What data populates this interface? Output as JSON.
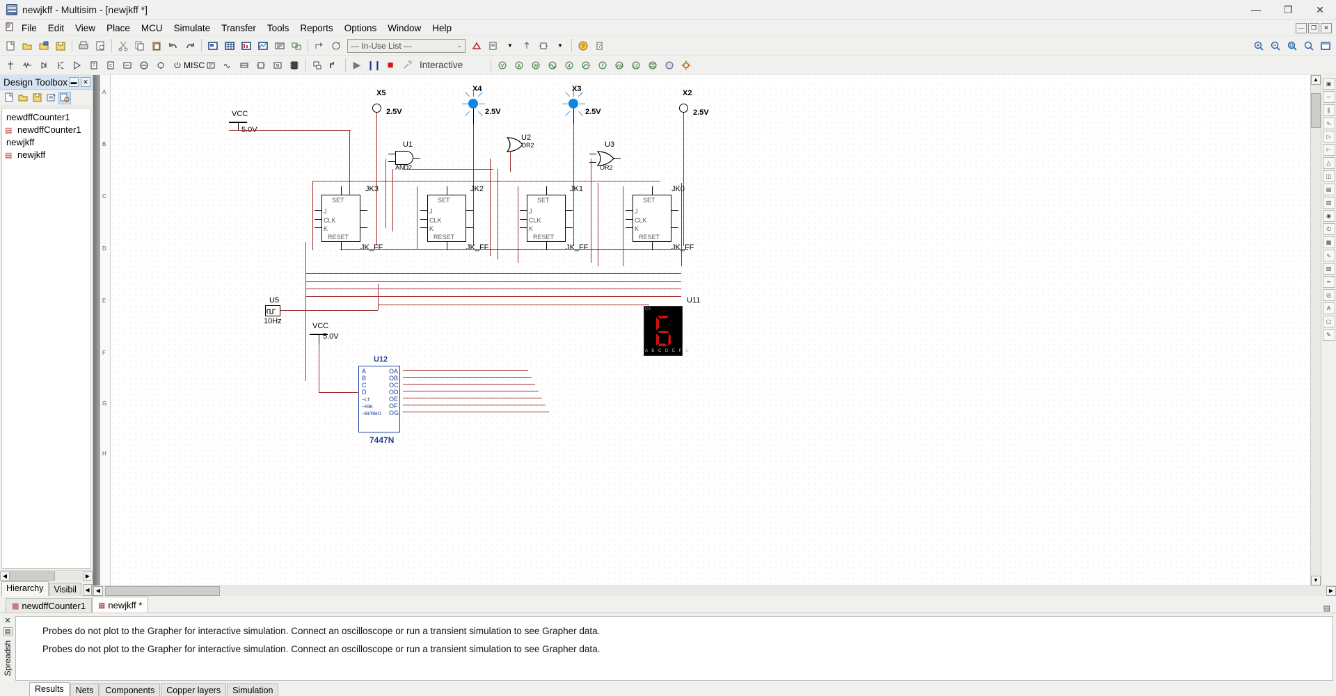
{
  "window": {
    "title": "newjkff - Multisim - [newjkff *]",
    "app_icon": "multisim-icon",
    "buttons": {
      "minimize": "—",
      "maximize": "❐",
      "close": "✕"
    }
  },
  "menubar": {
    "items": [
      "File",
      "Edit",
      "View",
      "Place",
      "MCU",
      "Simulate",
      "Transfer",
      "Tools",
      "Reports",
      "Options",
      "Window",
      "Help"
    ],
    "mdi_buttons": [
      "—",
      "❐",
      "✕"
    ]
  },
  "toolbar_main": {
    "groups": [
      [
        "new-document-icon",
        "open-document-icon",
        "open-design-icon",
        "save-icon"
      ],
      [
        "print-icon",
        "print-preview-icon"
      ],
      [
        "cut-icon",
        "copy-icon",
        "paste-icon",
        "undo-icon",
        "redo-icon"
      ],
      [
        "full-screen-icon",
        "grapher-icon",
        "postprocessor-icon",
        "analysis-icon",
        "electrical-rules-check-icon",
        "capture-screen-area-icon"
      ],
      [
        "back-annotate-icon",
        "forward-annotate-icon"
      ]
    ],
    "in_use_list": {
      "label": "--- In-Use List ---",
      "arrow": "⌄"
    },
    "right_icons": [
      "component-wizard-icon",
      "database-manager-icon",
      "dropdown-arrow-icon",
      "goto-parent-icon",
      "create-subcircuit-icon",
      "help-icon",
      "help-context-icon"
    ],
    "view_icons": [
      "zoom-in-icon",
      "zoom-out-icon",
      "zoom-area-icon",
      "zoom-fit-icon",
      "toggle-fullscreen-icon"
    ]
  },
  "toolbar_components": {
    "icons": [
      "source-icon",
      "basic-icon",
      "diode-icon",
      "transistor-icon",
      "analog-icon",
      "ttl-icon",
      "cmos-icon",
      "misc-digital-icon",
      "mixed-icon",
      "indicator-icon",
      "power-icon",
      "misc-icon",
      "advanced-peripherals-icon",
      "rf-icon",
      "electromechanical-icon",
      "connector-icon",
      "nilb-icon",
      "mcu-icon",
      "hierarchical-block-icon",
      "bus-icon"
    ],
    "sim_controls": {
      "run": "▶",
      "pause": "❙❙",
      "stop": "■",
      "mode_icon": "interactive-wrench-icon",
      "mode_label": "Interactive"
    },
    "instruments": [
      "multimeter-icon",
      "function-generator-icon",
      "wattmeter-icon",
      "oscilloscope-icon",
      "four-channel-oscilloscope-icon",
      "bode-plotter-icon",
      "frequency-counter-icon",
      "word-generator-icon",
      "logic-converter-icon",
      "logic-analyzer-icon",
      "iv-analyzer-icon",
      "distortion-analyzer-icon",
      "spectrum-analyzer-icon",
      "network-analyzer-icon",
      "agilent-instruments-icon"
    ]
  },
  "design_toolbox": {
    "title": "Design Toolbox",
    "header_buttons": [
      "minimize-panel-icon",
      "close-panel-icon"
    ],
    "toolbar_icons": [
      "new-sheet-icon",
      "open-sheet-icon",
      "save-sheet-icon",
      "rename-sheet-icon",
      "show-hierarchy-icon"
    ],
    "tree": [
      {
        "label": "newdffCounter1",
        "icon": "none",
        "level": 0
      },
      {
        "label": "newdffCounter1",
        "icon": "schematic-file-icon",
        "level": 1
      },
      {
        "label": "newjkff",
        "icon": "none",
        "level": 0
      },
      {
        "label": "newjkff",
        "icon": "schematic-file-icon",
        "level": 1
      }
    ],
    "tabs": [
      "Hierarchy",
      "Visibil"
    ],
    "tab_active": "Hierarchy",
    "nav_arrows": [
      "◀",
      "▶"
    ]
  },
  "document_tabs": {
    "tabs": [
      {
        "label": "newdffCounter1",
        "active": false,
        "icon": "schematic-file-icon"
      },
      {
        "label": "newjkff *",
        "active": true,
        "icon": "schematic-file-icon"
      }
    ]
  },
  "spreadsheet_view": {
    "vertical_label": "Spreadsh",
    "close_icon": "close-icon",
    "pin_icon": "pin-icon",
    "messages": [
      "Probes do not plot to the Grapher for interactive simulation. Connect an oscilloscope or run a transient simulation to see Grapher data.",
      "Probes do not plot to the Grapher for interactive simulation. Connect an oscilloscope or run a transient simulation to see Grapher data."
    ],
    "tabs": [
      "Results",
      "Nets",
      "Components",
      "Copper layers",
      "Simulation"
    ],
    "tab_active": "Results"
  },
  "schematic": {
    "ruler_labels_v": [
      "A",
      "B",
      "C",
      "D",
      "E",
      "F",
      "G",
      "H"
    ],
    "probes": [
      {
        "ref": "X5",
        "value": "2.5V",
        "state": "off"
      },
      {
        "ref": "X4",
        "value": "2.5V",
        "state": "on"
      },
      {
        "ref": "X3",
        "value": "2.5V",
        "state": "on"
      },
      {
        "ref": "X2",
        "value": "2.5V",
        "state": "off"
      }
    ],
    "power_sources": [
      {
        "ref": "VCC",
        "value": "5.0V"
      },
      {
        "ref": "VCC",
        "value": "5.0V"
      }
    ],
    "gates": [
      {
        "ref": "U1",
        "type": "AND2"
      },
      {
        "ref": "U2",
        "type": "OR2"
      },
      {
        "ref": "U3",
        "type": "OR2"
      }
    ],
    "flipflops": [
      {
        "ref": "JK3",
        "part": "JK_FF",
        "pins": [
          "SET",
          "J",
          "CLK",
          "K",
          "RESET"
        ]
      },
      {
        "ref": "JK2",
        "part": "JK_FF",
        "pins": [
          "SET",
          "J",
          "CLK",
          "K",
          "RESET"
        ]
      },
      {
        "ref": "JK1",
        "part": "JK_FF",
        "pins": [
          "SET",
          "J",
          "CLK",
          "K",
          "RESET"
        ]
      },
      {
        "ref": "JK0",
        "part": "JK_FF",
        "pins": [
          "SET",
          "J",
          "CLK",
          "K",
          "RESET"
        ]
      }
    ],
    "clock": {
      "ref": "U5",
      "value": "10Hz"
    },
    "decoder": {
      "ref": "U12",
      "part": "7447N",
      "inputs": [
        "A",
        "B",
        "C",
        "D",
        "~LT",
        "~RBI",
        "~BI/RBO"
      ],
      "outputs": [
        "OA",
        "OB",
        "OC",
        "OD",
        "OE",
        "OF",
        "OG"
      ]
    },
    "display": {
      "ref": "U11",
      "digit": "6",
      "common": "CA",
      "segments": "A B C D E F G"
    },
    "colors": {
      "wire": "#9e2a2a",
      "probe_on": "#1186e0",
      "label_blue": "#1f3f9e",
      "segment_red": "#cc1111"
    }
  }
}
